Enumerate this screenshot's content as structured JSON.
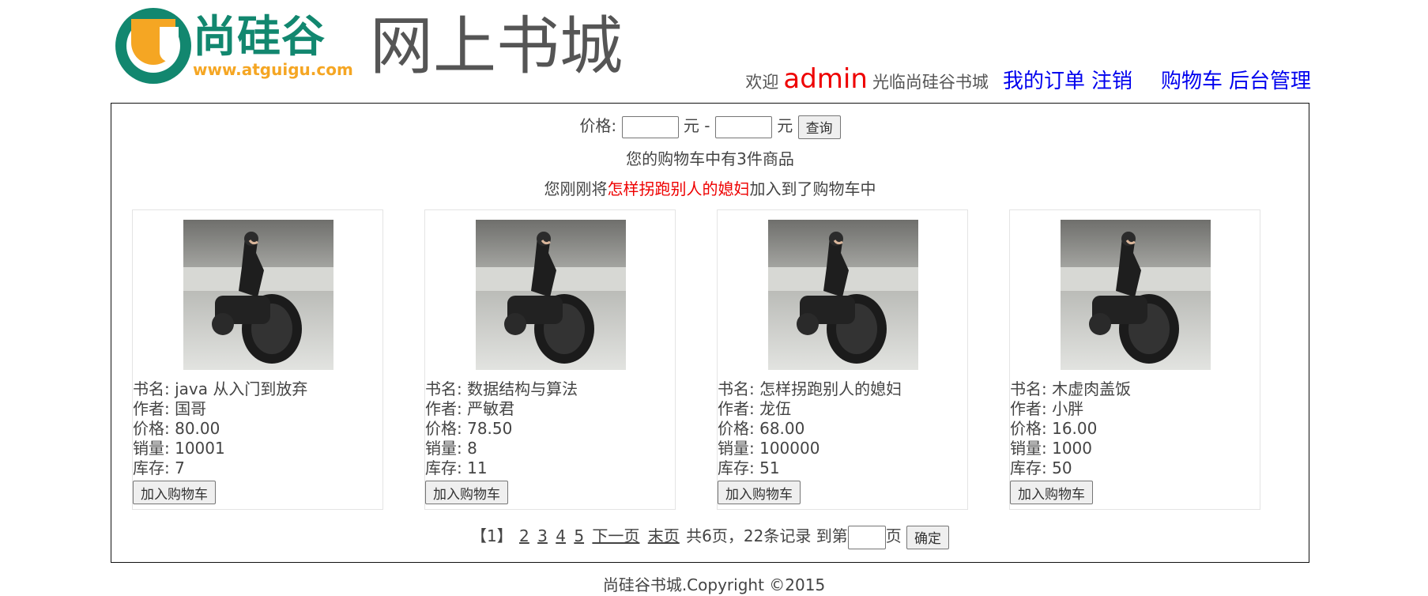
{
  "brand": {
    "logo_cn": "尚硅谷",
    "logo_url": "www.atguigu.com",
    "site_title": "网上书城"
  },
  "nav": {
    "welcome": "欢迎",
    "username": "admin",
    "welcome_suffix": "光临尚硅谷书城",
    "my_orders": "我的订单",
    "logout": "注销",
    "cart": "购物车",
    "admin": "后台管理"
  },
  "filter": {
    "label": "价格:",
    "min_value": "",
    "unit1": "元 -",
    "max_value": "",
    "unit2": "元",
    "query_button": "查询"
  },
  "cart_info": {
    "count_text": "您的购物车中有3件商品",
    "added_prefix": "您刚刚将",
    "added_book": "怎样拐跑别人的媳妇",
    "added_suffix": "加入到了购物车中"
  },
  "labels": {
    "name": "书名: ",
    "author": "作者: ",
    "price": "价格: ",
    "sales": "销量: ",
    "stock": "库存: ",
    "add_to_cart": "加入购物车"
  },
  "books": [
    {
      "name": "java 从入门到放弃",
      "author": "国哥",
      "price": "80.00",
      "sales": "10001",
      "stock": "7"
    },
    {
      "name": "数据结构与算法",
      "author": "严敏君",
      "price": "78.50",
      "sales": "8",
      "stock": "11"
    },
    {
      "name": "怎样拐跑别人的媳妇",
      "author": "龙伍",
      "price": "68.00",
      "sales": "100000",
      "stock": "51"
    },
    {
      "name": "木虚肉盖饭",
      "author": "小胖",
      "price": "16.00",
      "sales": "1000",
      "stock": "50"
    }
  ],
  "pagination": {
    "current": "【1】",
    "pages": [
      "2",
      "3",
      "4",
      "5"
    ],
    "next": "下一页",
    "last": "末页",
    "summary": "共6页，22条记录",
    "goto_label": "到第",
    "goto_value": "",
    "page_unit": "页",
    "confirm": "确定"
  },
  "footer": {
    "copyright": "尚硅谷书城.Copyright ©2015"
  },
  "colors": {
    "brand_green": "#12876f",
    "brand_orange": "#f5a623",
    "link_blue": "#0000ee",
    "highlight_red": "#e00"
  }
}
